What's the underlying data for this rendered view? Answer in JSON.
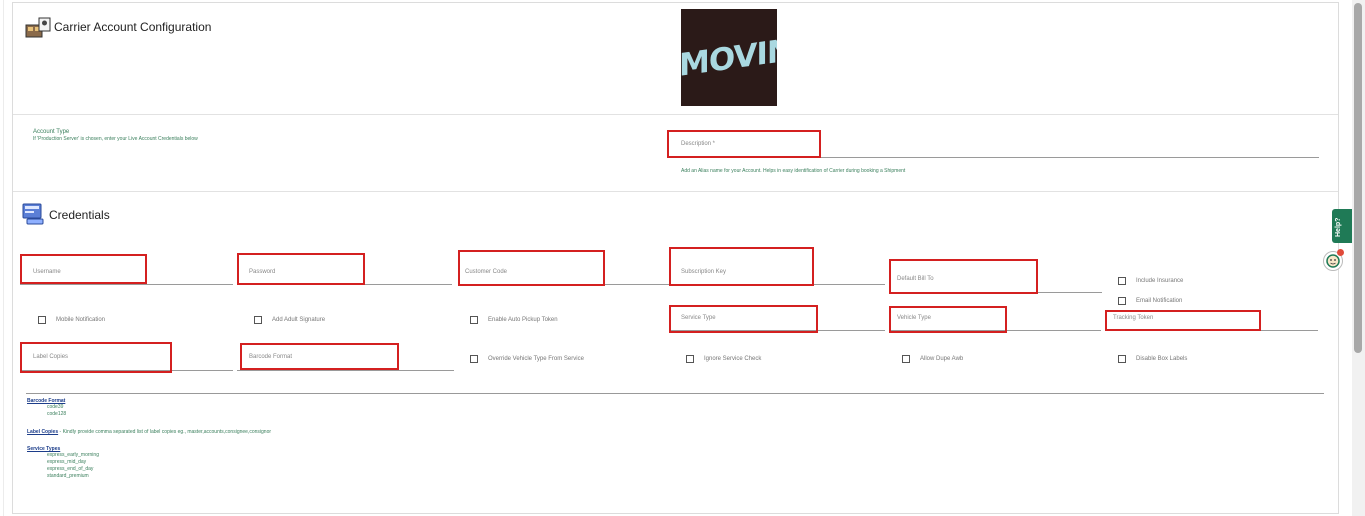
{
  "header": {
    "title": "Carrier Account Configuration",
    "icon": "carrier-config-icon"
  },
  "logo": {
    "text": "MOVIN",
    "bg": "#2b1a18",
    "fg": "#a9d8e0"
  },
  "account": {
    "label": "Account Type",
    "help": "If 'Production Server' is chosen, enter your Live Account Credentials below"
  },
  "description": {
    "placeholder": "Description *",
    "help": "Add an Alias name for your Account. Helps in easy identification of Carrier during booking a Shipment"
  },
  "credentials": {
    "title": "Credentials",
    "icon": "credentials-icon"
  },
  "fields": {
    "username": "Username",
    "password": "Password",
    "customer_code": "Customer Code",
    "subscription_key": "Subscription Key",
    "default_bill_to": "Default Bill To",
    "service_type": "Service Type",
    "vehicle_type": "Vehicle Type",
    "tracking_token": "Tracking Token",
    "label_copies": "Label Copies",
    "barcode_format": "Barcode Format"
  },
  "checkboxes": {
    "include_insurance": "Include Insurance",
    "email_notification": "Email Notification",
    "mobile_notification": "Mobile Notification",
    "add_adult_signature": "Add Adult Signature",
    "enable_auto_pickup_token": "Enable Auto Pickup Token",
    "override_vehicle_type": "Override Vehicle Type From Service",
    "ignore_service_check": "Ignore Service Check",
    "allow_dupe_awb": "Allow Dupe Awb",
    "disable_box_labels": "Disable Box Labels"
  },
  "notes": {
    "barcode_heading": "Barcode Format",
    "barcode_items": [
      "code39",
      "code128"
    ],
    "label_heading": "Label Copies",
    "label_text": " - Kindly provide comma separated list of label copies eg., master,accounts,consignee,consignor",
    "service_heading": "Service Types",
    "service_items": [
      "express_early_morning",
      "express_mid_day",
      "express_end_of_day",
      "standard_premium"
    ]
  },
  "help_tab": {
    "label": "Help?"
  },
  "colors": {
    "accent": "#1f7a56",
    "highlight": "#d42020",
    "note": "#3a7f5c"
  }
}
